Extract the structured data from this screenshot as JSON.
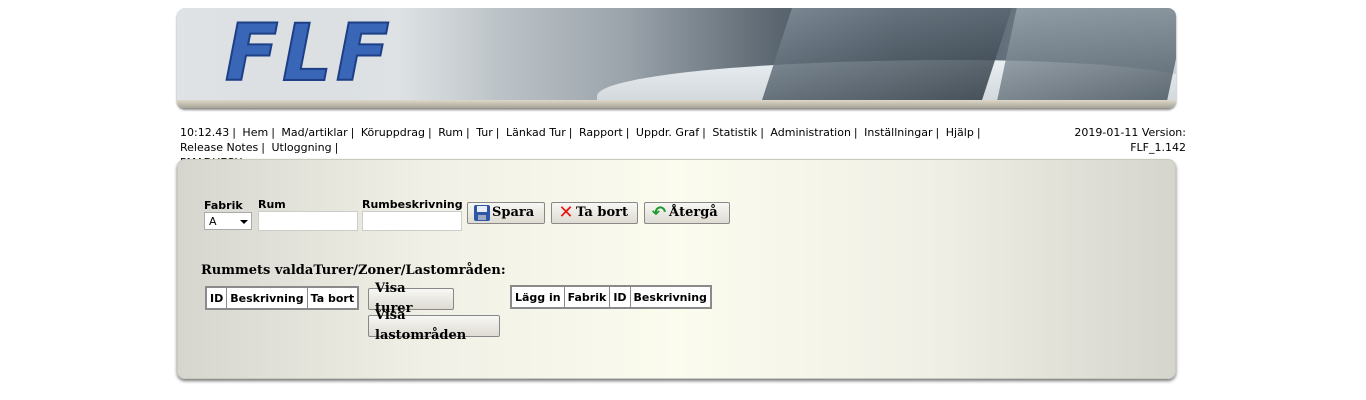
{
  "logo": {
    "text": "FLF"
  },
  "menu": {
    "time": "10:12.43",
    "items": [
      "Hem",
      "Mad/artiklar",
      "Köruppdrag",
      "Rum",
      "Tur",
      "Länkad Tur",
      "Rapport",
      "Uppdr. Graf",
      "Statistik",
      "Administration",
      "Inställningar",
      "Hjälp",
      "Release Notes",
      "Utloggning"
    ],
    "user": "PMADHESH"
  },
  "version": {
    "line1": "2019-01-11 Version:",
    "line2": "FLF_1.142"
  },
  "form": {
    "fabrik_label": "Fabrik",
    "fabrik_value": "A",
    "rum_label": "Rum",
    "rum_value": "",
    "rumbeskrivning_label": "Rumbeskrivning",
    "rumbeskrivning_value": "",
    "save_label": "Spara",
    "delete_label": "Ta bort",
    "revert_label": "Återgå"
  },
  "selected": {
    "heading": "Rummets valdaTurer/Zoner/Lastområden:",
    "columns": [
      "ID",
      "Beskrivning",
      "Ta bort"
    ]
  },
  "actions": {
    "show_tours": "Visa turer",
    "show_areas": "Visa lastområden"
  },
  "available": {
    "columns": [
      "Lägg in",
      "Fabrik",
      "ID",
      "Beskrivning"
    ]
  },
  "colors": {
    "logo_blue": "#3a66b8",
    "save_icon": "#2f55a6",
    "delete_icon": "#e11111",
    "revert_icon": "#1b9a2d"
  }
}
